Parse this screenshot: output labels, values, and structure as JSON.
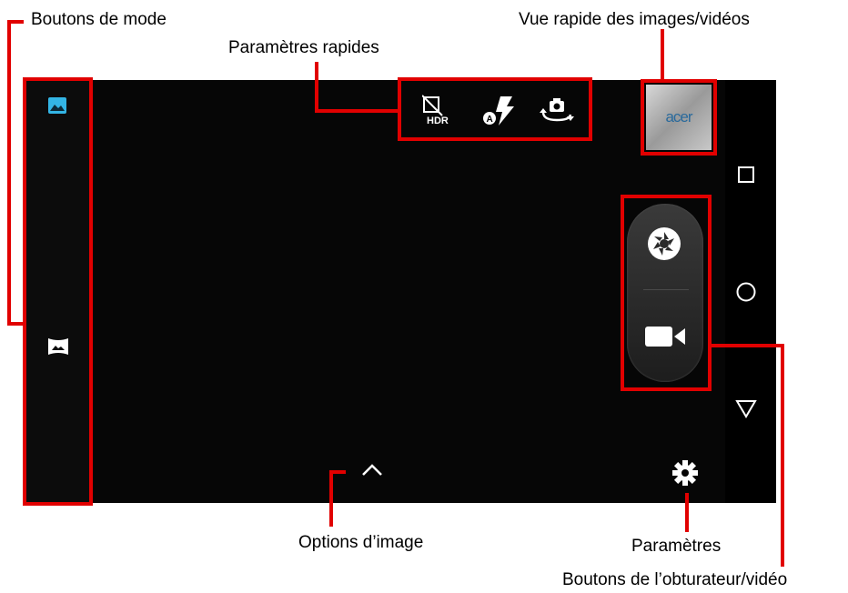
{
  "annotations": {
    "mode_buttons": "Boutons de mode",
    "quick_settings": "Paramètres rapides",
    "quick_view": "Vue rapide des images/vidéos",
    "image_options": "Options d’image",
    "settings": "Paramètres",
    "shutter_video_buttons": "Boutons de l’obturateur/vidéo"
  },
  "quick_settings": {
    "hdr_label": "HDR",
    "flash_mode_label": "A"
  },
  "thumbnail": {
    "brand_text": "acer"
  },
  "icons": {
    "photo_mode": "photo-mode-icon",
    "panorama_mode": "panorama-mode-icon",
    "hdr": "hdr-off-icon",
    "flash": "flash-auto-icon",
    "switch_camera": "switch-camera-icon",
    "shutter": "aperture-icon",
    "video": "video-camera-icon",
    "settings": "gear-icon",
    "image_options": "chevron-up-icon",
    "nav_recent": "square-icon",
    "nav_home": "circle-icon",
    "nav_back": "triangle-icon"
  },
  "colors": {
    "annotation_red": "#e10000",
    "active_mode_blue": "#33b5e5",
    "screen_bg": "#060606"
  }
}
